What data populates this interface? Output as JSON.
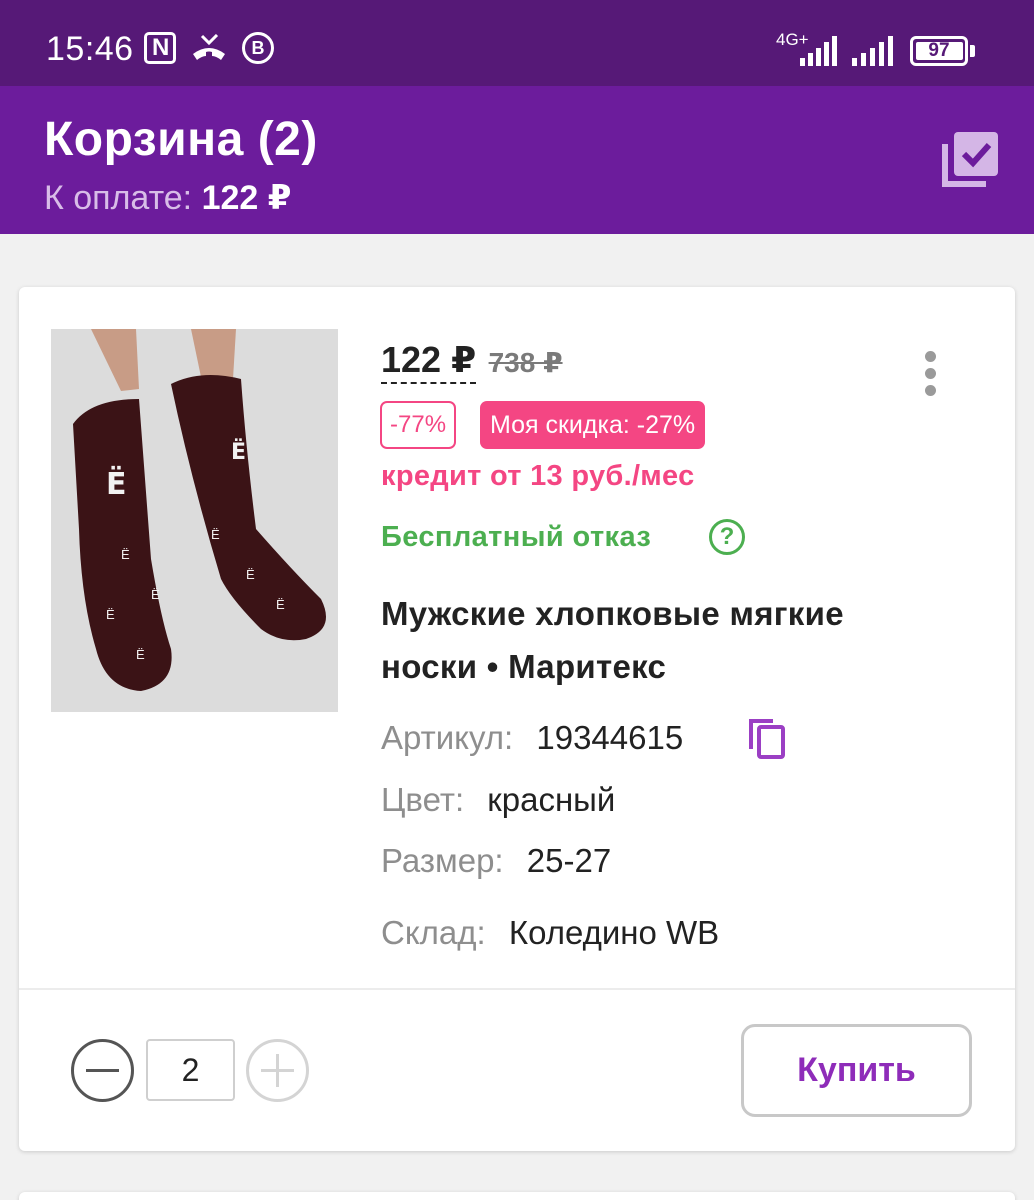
{
  "status_bar": {
    "time": "15:46",
    "network": "4G+",
    "battery": "97"
  },
  "header": {
    "title": "Корзина (2)",
    "pay_label": "К оплате:",
    "pay_value": "122 ₽"
  },
  "product": {
    "price": "122 ₽",
    "old_price": "738 ₽",
    "discount_badge": "-77%",
    "my_discount_label": "Моя скидка:",
    "my_discount_value": "-27%",
    "credit": "кредит от 13 руб./мес",
    "free_return": "Бесплатный отказ",
    "name_line1": "Мужские хлопковые мягкие",
    "name_line2": "носки • Маритекс",
    "article_label": "Артикул:",
    "article_value": "19344615",
    "color_label": "Цвет:",
    "color_value": "красный",
    "size_label": "Размер:",
    "size_value": "25-27",
    "warehouse_label": "Склад:",
    "warehouse_value": "Коледино WB"
  },
  "actions": {
    "quantity": "2",
    "buy_label": "Купить"
  },
  "colors": {
    "header": "#6c1c9c",
    "status_bar": "#561977",
    "accent_pink": "#f44683",
    "green": "#4caf50",
    "buy_text": "#8e2cb9"
  }
}
